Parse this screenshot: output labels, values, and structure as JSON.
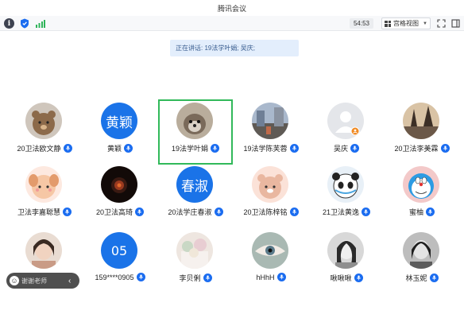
{
  "app": {
    "title": "腾讯会议"
  },
  "toolbar": {
    "timer": "54:53",
    "view_label": "宫格视图",
    "icons": [
      "info-icon",
      "shield-icon",
      "signal-icon",
      "fullscreen-icon",
      "side-panel-icon"
    ]
  },
  "banner": {
    "text": "正在讲话: 19法学叶娟; 吴庆;"
  },
  "participants": [
    {
      "name": "20卫法欧文静",
      "avatar_type": "photo",
      "avatar_theme": "bear",
      "avatar_color": "#8c6a4a"
    },
    {
      "name": "黄颖",
      "avatar_type": "text",
      "avatar_text": "黄颖",
      "avatar_color": "#1a73e8"
    },
    {
      "name": "19法学叶娟",
      "avatar_type": "photo",
      "avatar_theme": "dog",
      "avatar_color": "#7a6a5a",
      "speaking": true
    },
    {
      "name": "19法学陈芙蓉",
      "avatar_type": "photo",
      "avatar_theme": "street",
      "avatar_color": "#6f7f96"
    },
    {
      "name": "吴庆",
      "avatar_type": "default",
      "avatar_color": "#d9dbe0"
    },
    {
      "name": "20卫法李美霖",
      "avatar_type": "photo",
      "avatar_theme": "sunset",
      "avatar_color": "#b9a28b"
    },
    {
      "name": "卫法李嘉聪慧",
      "avatar_type": "photo",
      "avatar_theme": "cartoon-girl",
      "avatar_color": "#f6c7a5"
    },
    {
      "name": "20卫法高琦",
      "avatar_type": "photo",
      "avatar_theme": "dark",
      "avatar_color": "#3a1a12"
    },
    {
      "name": "20法学庄春淑",
      "avatar_type": "text",
      "avatar_text": "春淑",
      "avatar_color": "#1a73e8"
    },
    {
      "name": "20卫法陈梓铭",
      "avatar_type": "photo",
      "avatar_theme": "cartoon-bear",
      "avatar_color": "#e9b7a0"
    },
    {
      "name": "21卫法黄逸",
      "avatar_type": "photo",
      "avatar_theme": "panda",
      "avatar_color": "#e8f0f7"
    },
    {
      "name": "蜜柚",
      "avatar_type": "photo",
      "avatar_theme": "doraemon",
      "avatar_color": "#f3c9c9"
    },
    {
      "name": "",
      "avatar_type": "photo",
      "avatar_theme": "portrait",
      "avatar_color": "#c99b86"
    },
    {
      "name": "159****0905",
      "avatar_type": "text",
      "avatar_text": "05",
      "avatar_color": "#1a73e8"
    },
    {
      "name": "李贝俐",
      "avatar_type": "photo",
      "avatar_theme": "flowers",
      "avatar_color": "#d9cfc8"
    },
    {
      "name": "hHhH",
      "avatar_type": "photo",
      "avatar_theme": "eye",
      "avatar_color": "#a9b9b3"
    },
    {
      "name": "啾啾啾",
      "avatar_type": "photo",
      "avatar_theme": "bw-girl",
      "avatar_color": "#8e8e8e"
    },
    {
      "name": "林玉妮",
      "avatar_type": "photo",
      "avatar_theme": "bw-portrait",
      "avatar_color": "#5c5c5c"
    }
  ],
  "chat": {
    "preview": "谢谢老师",
    "icon": "smile-icon"
  },
  "colors": {
    "accent": "#1a6cf0",
    "speaking_border": "#31b95a",
    "banner_bg": "#e3eefc"
  }
}
